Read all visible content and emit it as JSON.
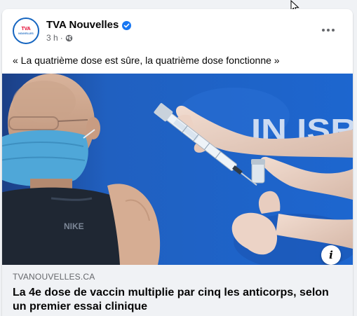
{
  "post": {
    "page_name": "TVA Nouvelles",
    "avatar_logo": "TVA",
    "avatar_logo_sub": "NOUVELLES",
    "verified_icon": "verified-badge-icon",
    "timestamp": "3 h",
    "separator": "·",
    "audience_icon": "globe-icon",
    "more_icon": "more-options-icon",
    "text": "« La quatrième dose est sûre, la quatrième dose fonctionne »"
  },
  "photo": {
    "sign_text": "IN ISR",
    "info_label": "i"
  },
  "link_preview": {
    "domain": "TVANOUVELLES.CA",
    "title": "La 4e dose de vaccin multiplie par cinq les anticorps, selon un premier essai clinique"
  },
  "colors": {
    "accent": "#1877f2",
    "page_bg": "#f0f2f5",
    "photo_blue": "#1e63c6"
  }
}
